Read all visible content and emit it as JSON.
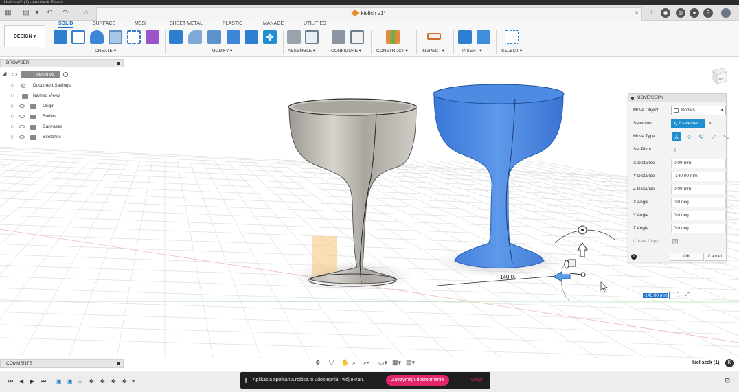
{
  "window": {
    "title": "kielich v1* (1) - Autodesk Fusion"
  },
  "document_tab": {
    "title": "kielich v1*"
  },
  "workspace": {
    "label": "DESIGN"
  },
  "ribbon": {
    "tabs": [
      {
        "label": "SOLID",
        "active": true
      },
      {
        "label": "SURFACE",
        "active": false
      },
      {
        "label": "MESH",
        "active": false
      },
      {
        "label": "SHEET METAL",
        "active": false
      },
      {
        "label": "PLASTIC",
        "active": false
      },
      {
        "label": "MANAGE",
        "active": false
      },
      {
        "label": "UTILITIES",
        "active": false
      }
    ],
    "groups": [
      "CREATE",
      "MODIFY",
      "ASSEMBLE",
      "CONFIGURE",
      "CONSTRUCT",
      "INSPECT",
      "INSERT",
      "SELECT"
    ]
  },
  "browser": {
    "title": "BROWSER",
    "root": "kielich v1",
    "items": [
      "Document Settings",
      "Named Views",
      "Origin",
      "Bodies",
      "Canvases",
      "Sketches"
    ]
  },
  "move_copy": {
    "title": "MOVE/COPY",
    "move_object": {
      "label": "Move Object",
      "value": "Bodies"
    },
    "selection": {
      "label": "Selection",
      "value": "1 selected"
    },
    "move_type": {
      "label": "Move Type"
    },
    "set_pivot": {
      "label": "Set Pivot"
    },
    "fields": [
      {
        "label": "X Distance",
        "value": "0.00 mm"
      },
      {
        "label": "Y Distance",
        "value": "-140.00 mm"
      },
      {
        "label": "Z Distance",
        "value": "0.00 mm"
      },
      {
        "label": "X Angle",
        "value": "0.0 deg"
      },
      {
        "label": "Y Angle",
        "value": "0.0 deg"
      },
      {
        "label": "Z Angle",
        "value": "0.0 deg"
      }
    ],
    "create_copy": {
      "label": "Create Copy"
    },
    "ok": "OK",
    "cancel": "Cancel"
  },
  "viewport": {
    "dimension_label": "140.00",
    "distance_input": "-140.00 mm",
    "view_cube_label": "LEFT",
    "axis_colors": {
      "x": "#e06060",
      "y": "#60b060",
      "body": "#3d7fe0",
      "ghost": "#b8b6ae"
    }
  },
  "comments": {
    "title": "COMMENTS"
  },
  "user": {
    "name": "kieliszek (1)"
  },
  "share_banner": {
    "message": "Aplikacja spotkania.robisz.to udostępnia Twój ekran.",
    "stop_label": "Zatrzymaj udostępnianie",
    "hide_label": "Ukryj"
  }
}
